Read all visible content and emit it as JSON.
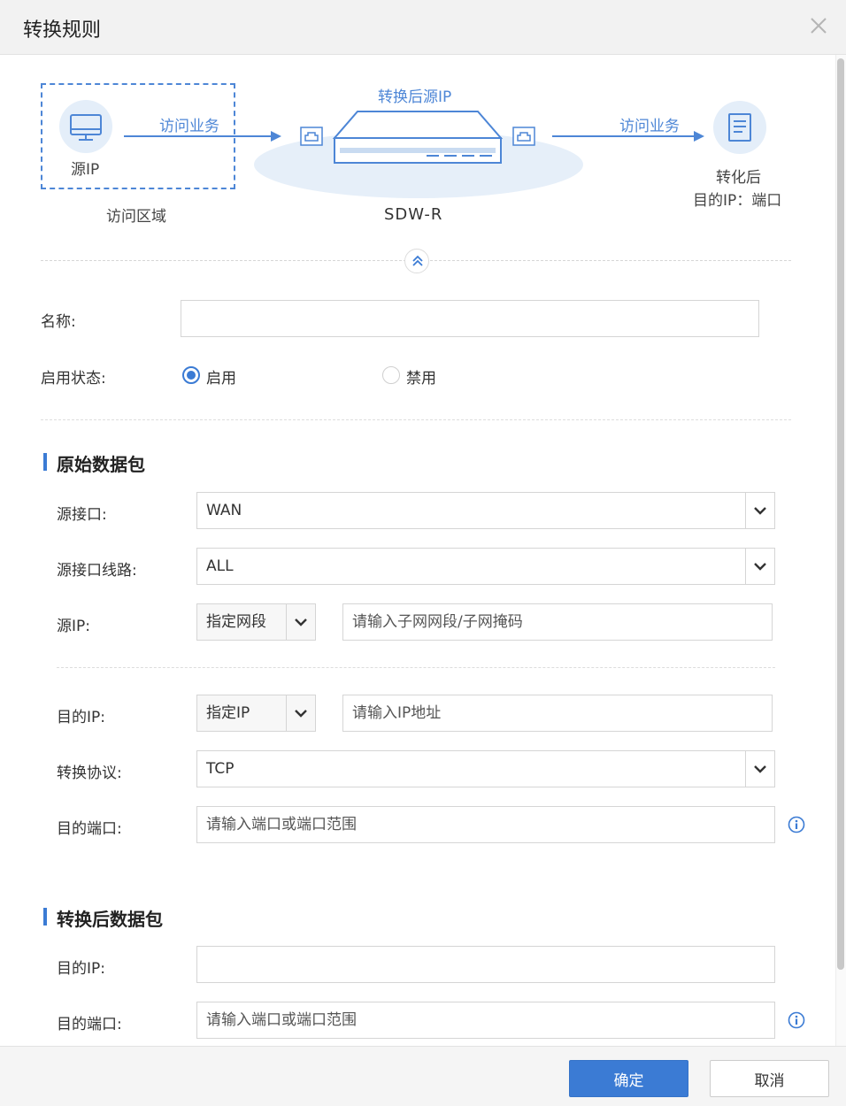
{
  "dialog": {
    "title": "转换规则"
  },
  "diagram": {
    "source_ip": "源IP",
    "access_service_left": "访问业务",
    "access_zone": "访问区域",
    "translated_source_ip": "转换后源IP",
    "device_name": "SDW-R",
    "access_service_right": "访问业务",
    "translated_label_line1": "转化后",
    "translated_label_line2": "目的IP：端口",
    "icon_monitor": "monitor-icon",
    "icon_router": "router-icon",
    "icon_document": "document-icon"
  },
  "form": {
    "name_label": "名称:",
    "name_value": "",
    "status_label": "启用状态:",
    "status_enabled": "启用",
    "status_disabled": "禁用",
    "status_selected": "启用"
  },
  "original_packet": {
    "title": "原始数据包",
    "source_interface_label": "源接口:",
    "source_interface_value": "WAN",
    "source_line_label": "源接口线路:",
    "source_line_value": "ALL",
    "source_ip_label": "源IP:",
    "source_ip_type": "指定网段",
    "source_ip_placeholder": "请输入子网网段/子网掩码",
    "dest_ip_label": "目的IP:",
    "dest_ip_type": "指定IP",
    "dest_ip_placeholder": "请输入IP地址",
    "protocol_label": "转换协议:",
    "protocol_value": "TCP",
    "dest_port_label": "目的端口:",
    "dest_port_placeholder": "请输入端口或端口范围"
  },
  "translated_packet": {
    "title": "转换后数据包",
    "dest_ip_label": "目的IP:",
    "dest_ip_value": "",
    "dest_port_label": "目的端口:",
    "dest_port_placeholder": "请输入端口或端口范围"
  },
  "footer": {
    "ok_label": "确定",
    "cancel_label": "取消"
  },
  "colors": {
    "accent": "#3b7bd4",
    "diagram_blue": "#4d86d6"
  }
}
